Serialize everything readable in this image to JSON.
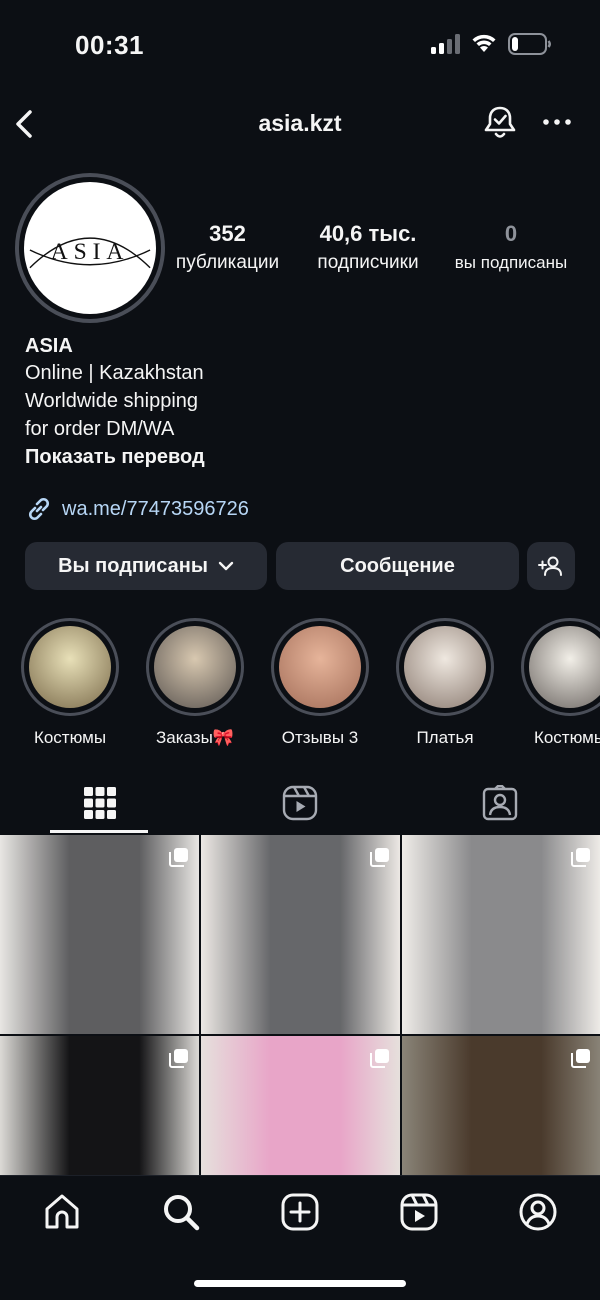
{
  "status_bar": {
    "time": "00:31"
  },
  "nav": {
    "username": "asia.kzt"
  },
  "profile": {
    "avatar_logo": "ASIA",
    "stats": {
      "posts": {
        "value": "352",
        "label": "публикации"
      },
      "followers": {
        "value": "40,6 тыс.",
        "label": "подписчики"
      },
      "following": {
        "value": "0",
        "label": "вы подписаны"
      }
    },
    "name": "ASIA",
    "bio_lines": [
      "Online | Kazakhstan",
      "Worldwide shipping",
      "for order DM/WA"
    ],
    "translate_label": "Показать перевод",
    "link": "wa.me/77473596726"
  },
  "buttons": {
    "following_label": "Вы подписаны",
    "message_label": "Сообщение"
  },
  "highlights": [
    {
      "label": "Костюмы",
      "colors": [
        "#e8e0b8",
        "#7a6a4a"
      ]
    },
    {
      "label": "Заказы🎀",
      "colors": [
        "#d8c8b0",
        "#5a5450"
      ]
    },
    {
      "label": "Отзывы 3",
      "colors": [
        "#e6b49a",
        "#a26d58"
      ]
    },
    {
      "label": "Платья",
      "colors": [
        "#efe8e0",
        "#8a7a70"
      ]
    },
    {
      "label": "Костюмы",
      "colors": [
        "#f2efe8",
        "#6a6460"
      ]
    }
  ],
  "tabs": [
    {
      "name": "grid-icon",
      "active": true
    },
    {
      "name": "reels-icon",
      "active": false
    },
    {
      "name": "tagged-icon",
      "active": false
    }
  ],
  "posts": [
    {
      "subject": "grey suit with belt",
      "colors": [
        "#e8e6e3",
        "#5e5e60"
      ]
    },
    {
      "subject": "grey blazer dress",
      "colors": [
        "#ece8e4",
        "#66676a"
      ]
    },
    {
      "subject": "grey waistcoat and trousers",
      "colors": [
        "#efece8",
        "#8a8a8c"
      ]
    },
    {
      "subject": "black blazer with brooch",
      "colors": [
        "#dcdad6",
        "#141416"
      ]
    },
    {
      "subject": "pink hoodie set",
      "colors": [
        "#e6e0dc",
        "#e8a5c8"
      ]
    },
    {
      "subject": "brown wool coat",
      "colors": [
        "#8a8478",
        "#4a3a2c"
      ]
    }
  ],
  "bottom_nav": [
    "home-icon",
    "search-icon",
    "create-icon",
    "reels-icon",
    "profile-icon"
  ]
}
